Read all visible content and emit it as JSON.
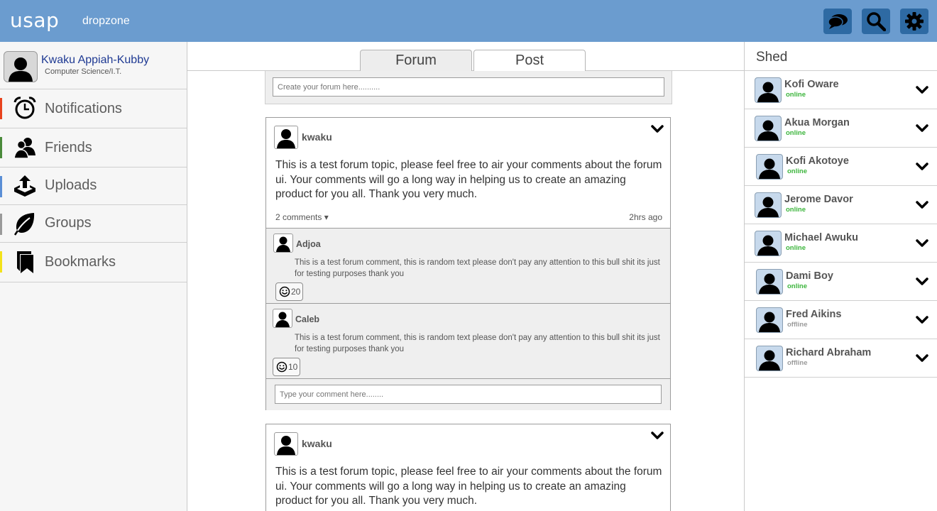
{
  "header": {
    "logo": "usap",
    "subtitle": "dropzone",
    "buttons": [
      {
        "name": "chat-icon"
      },
      {
        "name": "search-icon"
      },
      {
        "name": "gear-icon"
      }
    ],
    "color": "#6b9ccf",
    "button_color": "#2e6aa3"
  },
  "profile": {
    "name": "Kwaku Appiah-Kubby",
    "department": "Computer Science/I.T."
  },
  "nav": [
    {
      "label": "Notifications",
      "icon": "alarm-clock-icon",
      "accent": "#e8431e"
    },
    {
      "label": "Friends",
      "icon": "friends-icon",
      "accent": "#4a8a3a"
    },
    {
      "label": "Uploads",
      "icon": "upload-icon",
      "accent": "#5b8fd6"
    },
    {
      "label": "Groups",
      "icon": "leaf-icon",
      "accent": "#9a9a9a"
    },
    {
      "label": "Bookmarks",
      "icon": "bookmark-icon",
      "accent": "#f3e21a"
    }
  ],
  "tabs": {
    "forum": "Forum",
    "post": "Post"
  },
  "create_forum": {
    "placeholder": "Create your forum here.........."
  },
  "posts": [
    {
      "author": "kwaku",
      "body": "This is a test forum topic, please feel free to air your comments about the forum ui. Your comments will go a long way in helping us to create an amazing product for you all. Thank you very much.",
      "comments_link": "2 comments ▾",
      "time": "2hrs ago",
      "comments": [
        {
          "author": "Adjoa",
          "text": "This is a test forum comment, this is random text please don't pay any attention to this bull shit its just for testing purposes thank you",
          "likes": "20"
        },
        {
          "author": "Caleb",
          "text": "This is a test forum comment, this is random text please don't pay any attention to this bull shit its just for testing purposes thank you",
          "likes": "10"
        }
      ],
      "reply_placeholder": "Type your comment here........"
    },
    {
      "author": "kwaku",
      "body": "This is a test forum topic, please feel free to air your comments about the forum ui. Your comments will go a long way in helping us to create an amazing product for you all. Thank you very much."
    }
  ],
  "shed": {
    "title": "Shed",
    "friends": [
      {
        "name": "Kofi Oware",
        "status": "online"
      },
      {
        "name": "Akua Morgan",
        "status": "online"
      },
      {
        "name": "Kofi Akotoye",
        "status": "online"
      },
      {
        "name": "Jerome Davor",
        "status": "online"
      },
      {
        "name": "Michael Awuku",
        "status": "online"
      },
      {
        "name": "Dami Boy",
        "status": "online"
      },
      {
        "name": "Fred Aikins",
        "status": "offline"
      },
      {
        "name": "Richard Abraham",
        "status": "offline"
      }
    ],
    "online_color": "#3cb53c",
    "offline_color": "#9a9a9a"
  }
}
